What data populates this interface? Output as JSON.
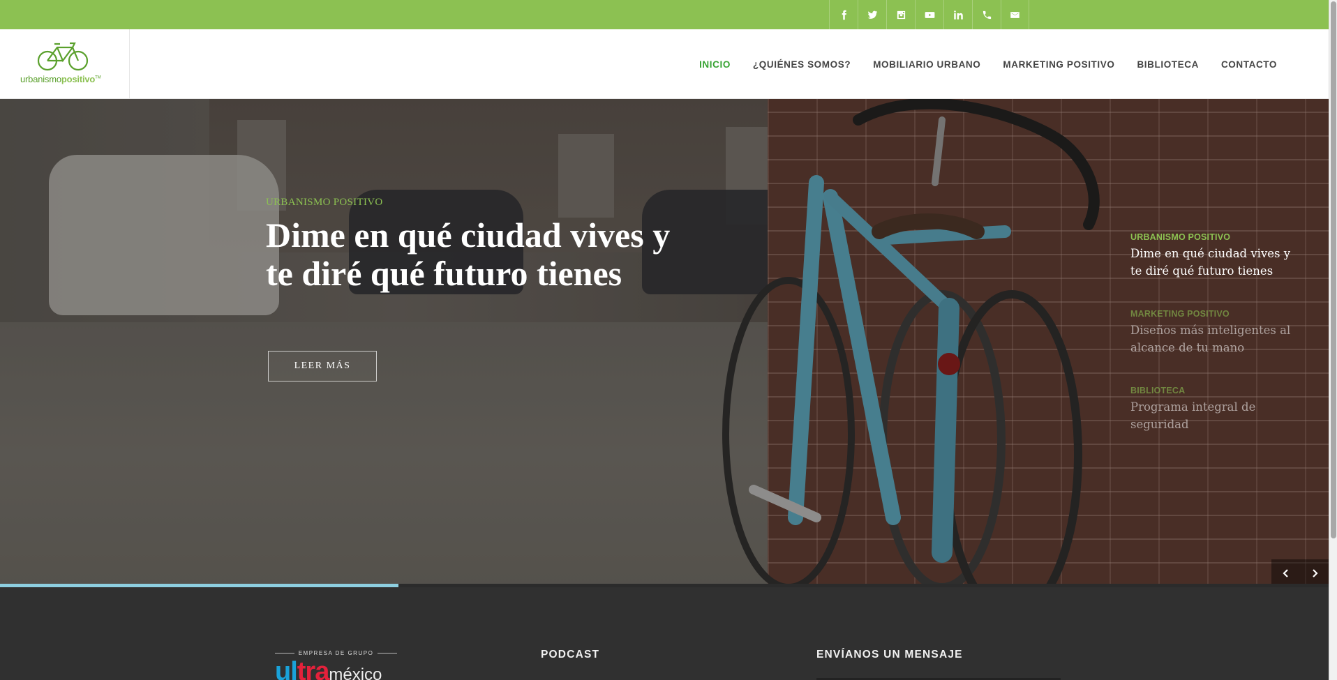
{
  "topbar": {
    "bg_color": "#8cc152",
    "social": [
      {
        "icon": "facebook-icon"
      },
      {
        "icon": "twitter-icon"
      },
      {
        "icon": "instagram-icon"
      },
      {
        "icon": "youtube-icon"
      },
      {
        "icon": "linkedin-icon"
      },
      {
        "icon": "phone-icon"
      },
      {
        "icon": "mail-icon"
      }
    ]
  },
  "header": {
    "logo": {
      "text_a": "urbanismo",
      "text_b": "positivo",
      "tm": "TM"
    },
    "nav": [
      {
        "label": "INICIO",
        "active": true
      },
      {
        "label": "¿QUIÉNES SOMOS?",
        "active": false
      },
      {
        "label": "MOBILIARIO URBANO",
        "active": false
      },
      {
        "label": "MARKETING POSITIVO",
        "active": false
      },
      {
        "label": "BIBLIOTECA",
        "active": false
      },
      {
        "label": "CONTACTO",
        "active": false
      }
    ],
    "active_color": "#37a333"
  },
  "hero": {
    "kicker": "URBANISMO POSITIVO",
    "title": "Dime en qué ciudad vives y te diré qué futuro tienes",
    "button": "LEER MÁS",
    "slides": [
      {
        "kicker": "URBANISMO POSITIVO",
        "title": "Dime en qué ciudad vives y te diré qué futuro tienes",
        "active": true
      },
      {
        "kicker": "MARKETING POSITIVO",
        "title": "Diseños más inteligentes al alcance de tu mano",
        "active": false
      },
      {
        "kicker": "BIBLIOTECA",
        "title": "Programa integral de seguridad",
        "active": false
      }
    ],
    "progress": 0.3,
    "progress_color": "#8ecfe0",
    "prev_icon": "chevron-left-icon",
    "next_icon": "chevron-right-icon"
  },
  "footer": {
    "ultra": {
      "top": "EMPRESA DE GRUPO",
      "u1": "ul",
      "u2": "tra",
      "u3": "",
      "mx": "méxico"
    },
    "podcast_heading": "PODCAST",
    "contact_heading": "ENVÍANOS UN MENSAJE"
  }
}
